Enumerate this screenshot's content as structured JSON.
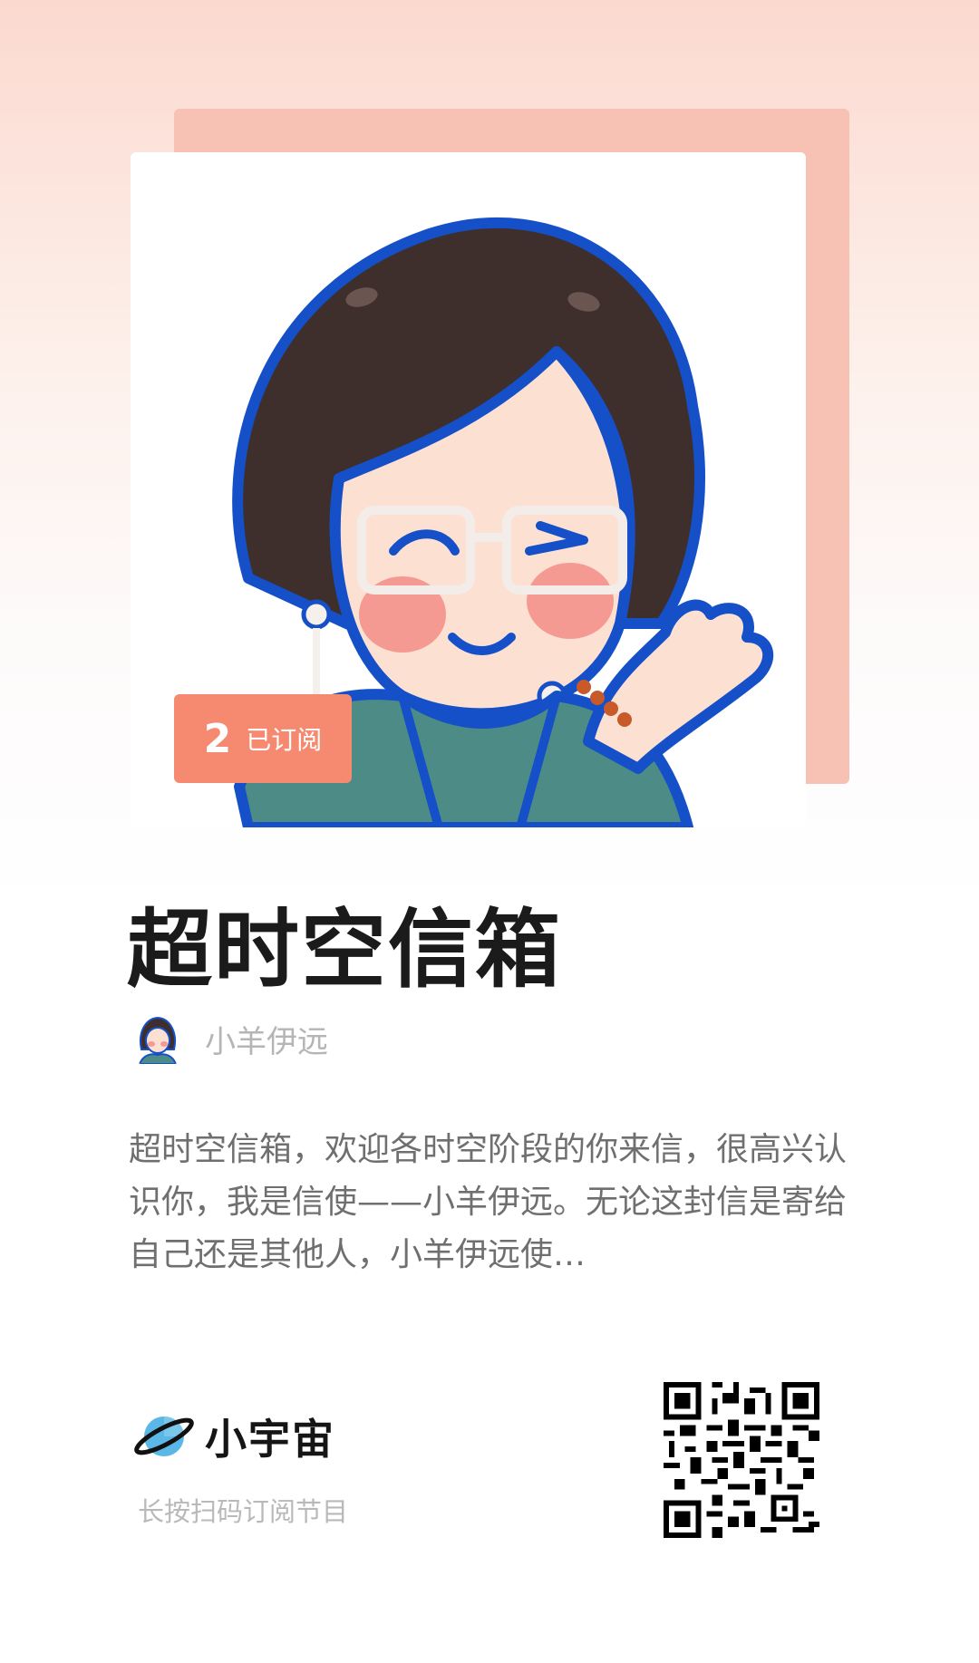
{
  "podcast": {
    "title": "超时空信箱",
    "author": "小羊伊远",
    "description": "超时空信箱，欢迎各时空阶段的你来信，很高兴认识你，我是信使——小羊伊远。无论这封信是寄给自己还是其他人，小羊伊远使…",
    "subscribed_count": "2",
    "subscribed_label": "已订阅"
  },
  "brand": {
    "name": "小宇宙",
    "icon": "planet-icon"
  },
  "hint": "长按扫码订阅节目",
  "colors": {
    "accent": "#f58a70",
    "cover_back": "#f7c1b3",
    "outline_blue": "#1550c8"
  }
}
